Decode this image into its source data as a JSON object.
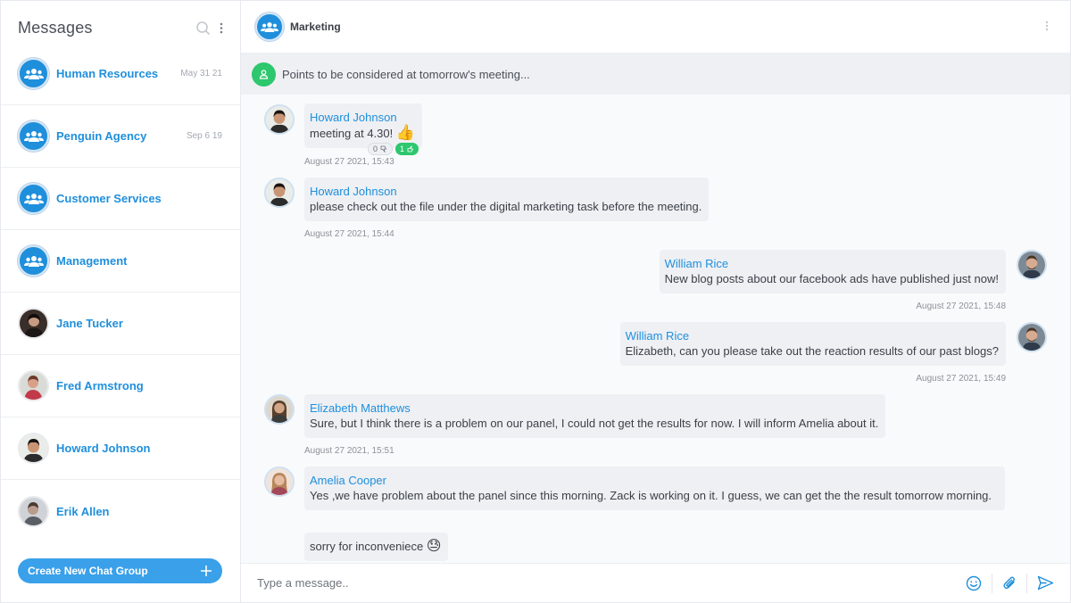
{
  "sidebar": {
    "title": "Messages",
    "search_icon": "search-icon",
    "more_icon": "more-vertical-icon",
    "conversations": [
      {
        "name": "Human Resources",
        "date": "May 31 21",
        "type": "group"
      },
      {
        "name": "Penguin Agency",
        "date": "Sep 6 19",
        "type": "group"
      },
      {
        "name": "Customer Services",
        "date": "",
        "type": "group"
      },
      {
        "name": "Management",
        "date": "",
        "type": "group"
      },
      {
        "name": "Jane Tucker",
        "date": "",
        "type": "person"
      },
      {
        "name": "Fred Armstrong",
        "date": "",
        "type": "person"
      },
      {
        "name": "Howard Johnson",
        "date": "",
        "type": "person"
      },
      {
        "name": "Erik Allen",
        "date": "",
        "type": "person"
      }
    ],
    "create_button": "Create New Chat Group"
  },
  "chat": {
    "title": "Marketing",
    "pinned": "Points to be considered at tomorrow's meeting...",
    "messages": [
      {
        "author": "Howard Johnson",
        "text": "meeting at 4.30!",
        "emoji": "👍",
        "time": "August 27 2021, 15:43",
        "dislikes": "0",
        "likes": "1"
      },
      {
        "author": "Howard Johnson",
        "text": "please check out the file under the digital marketing task before the meeting.",
        "time": "August 27 2021, 15:44"
      },
      {
        "author": "William Rice",
        "text": "New blog posts about our facebook ads have published just now!",
        "time": "August 27 2021, 15:48"
      },
      {
        "author": "William Rice",
        "text": "Elizabeth, can you please take out the reaction results of our past blogs?",
        "time": "August 27 2021, 15:49"
      },
      {
        "author": "Elizabeth Matthews",
        "text": "Sure, but I think there is a problem on our panel,  I could not get the results for now. I will inform Amelia about it.",
        "time": "August 27 2021, 15:51"
      },
      {
        "author": "Amelia Cooper",
        "text": "Yes ,we have problem about the panel since this morning. Zack is working on it. I guess, we can get the the result tomorrow morning."
      },
      {
        "author": "",
        "text": "sorry for inconveniece",
        "emoji": "😓"
      }
    ]
  },
  "composer": {
    "placeholder": "Type a message..",
    "emoji_icon": "smile-icon",
    "attach_icon": "paperclip-icon",
    "send_icon": "send-icon"
  },
  "colors": {
    "accent": "#1f8fdc",
    "button": "#3aa0ea",
    "success": "#2dc76d",
    "bubble": "#eef0f4"
  }
}
